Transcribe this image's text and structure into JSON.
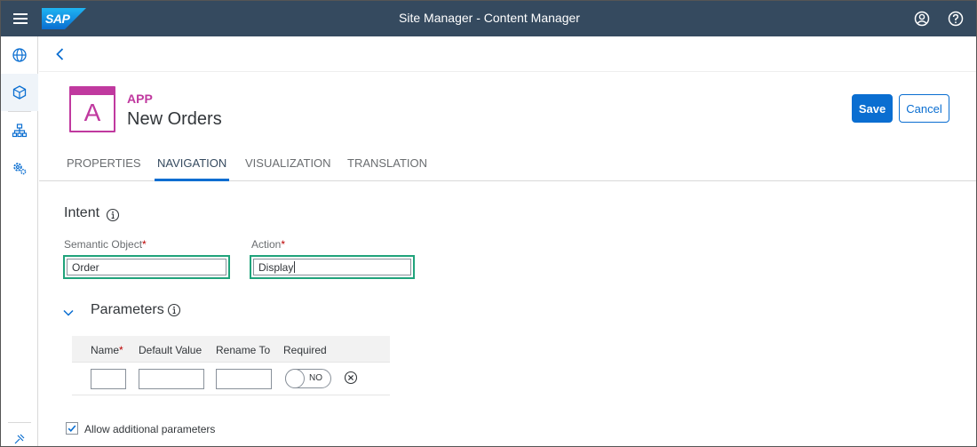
{
  "shell": {
    "title": "Site Manager - Content Manager",
    "logo_text": "SAP",
    "icons": [
      "menu-icon",
      "user-icon",
      "help-icon"
    ]
  },
  "sidenav": {
    "items": [
      {
        "icon": "globe-icon",
        "active": false
      },
      {
        "icon": "cube-icon",
        "active": true
      },
      {
        "icon": "sitemap-icon",
        "active": false
      },
      {
        "icon": "settings-icon",
        "active": false
      }
    ]
  },
  "app": {
    "tile_letter": "A",
    "type_label": "APP",
    "title": "New Orders",
    "accent_color": "#c0399f"
  },
  "actions": {
    "save_label": "Save",
    "cancel_label": "Cancel"
  },
  "tabs": [
    {
      "label": "PROPERTIES",
      "active": false
    },
    {
      "label": "NAVIGATION",
      "active": true
    },
    {
      "label": "VISUALIZATION",
      "active": false
    },
    {
      "label": "TRANSLATION",
      "active": false
    }
  ],
  "intent": {
    "title": "Intent",
    "semantic_object": {
      "label": "Semantic Object",
      "required_mark": "*",
      "value": "Order"
    },
    "action": {
      "label": "Action",
      "required_mark": "*",
      "value": "Display"
    }
  },
  "parameters": {
    "title": "Parameters",
    "columns": [
      {
        "label": "Name",
        "required_mark": "*"
      },
      {
        "label": "Default Value",
        "required_mark": ""
      },
      {
        "label": "Rename To",
        "required_mark": ""
      },
      {
        "label": "Required",
        "required_mark": ""
      }
    ],
    "row": {
      "name": "",
      "default_value": "",
      "rename_to": "",
      "required_toggle": "NO"
    }
  },
  "allow_additional": {
    "label": "Allow additional parameters",
    "checked": true
  },
  "colors": {
    "shell_bg": "#354a5f",
    "brand_blue": "#0a6ed1",
    "highlight_green": "#20a37b",
    "required_red": "#bb0000"
  }
}
